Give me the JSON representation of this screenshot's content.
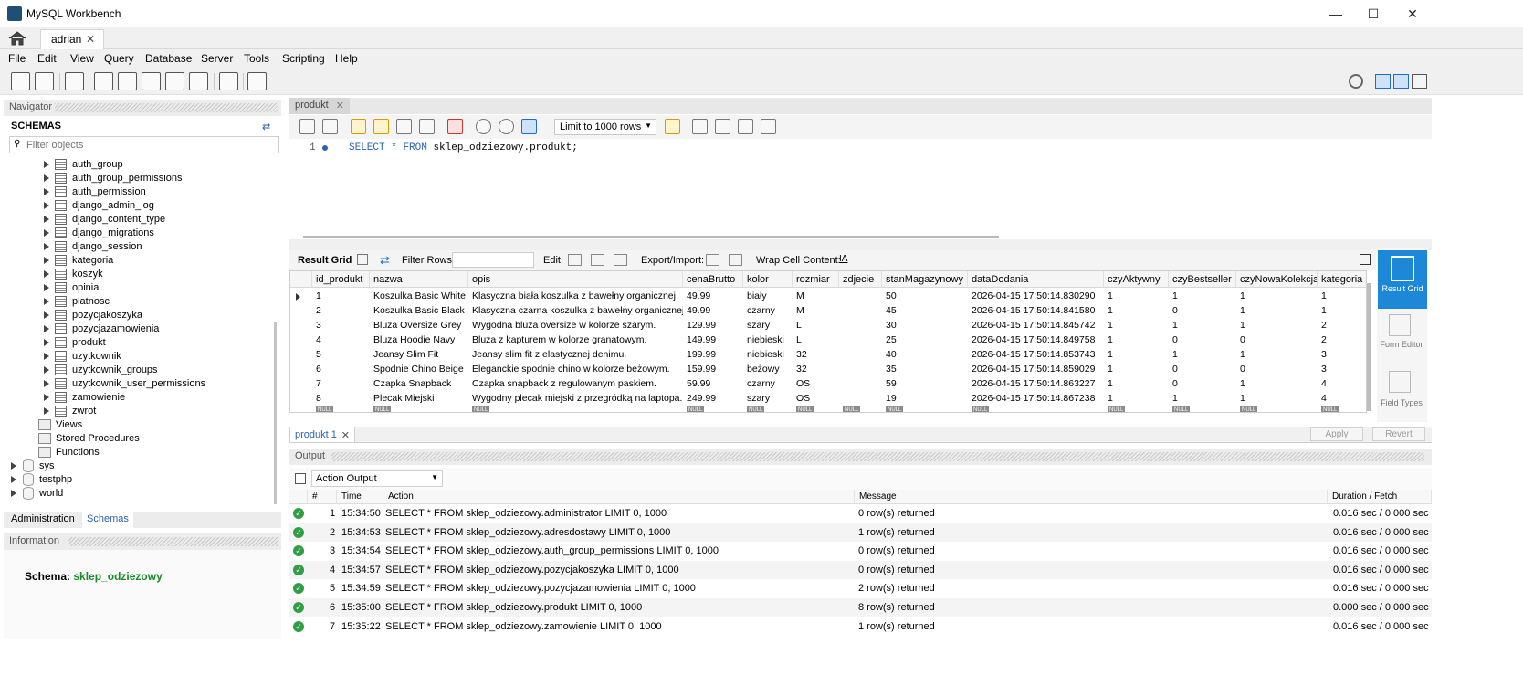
{
  "window": {
    "title": "MySQL Workbench",
    "controls": [
      "minimize",
      "maximize",
      "close"
    ]
  },
  "connection_tab": {
    "label": "adrian",
    "close": "✕"
  },
  "menu": [
    "File",
    "Edit",
    "View",
    "Query",
    "Database",
    "Server",
    "Tools",
    "Scripting",
    "Help"
  ],
  "navigator": {
    "header": "Navigator",
    "schemas_title": "SCHEMAS",
    "filter_placeholder": "Filter objects",
    "tables": [
      "auth_group",
      "auth_group_permissions",
      "auth_permission",
      "django_admin_log",
      "django_content_type",
      "django_migrations",
      "django_session",
      "kategoria",
      "koszyk",
      "opinia",
      "platnosc",
      "pozycjakoszyka",
      "pozycjazamowienia",
      "produkt",
      "uzytkownik",
      "uzytkownik_groups",
      "uzytkownik_user_permissions",
      "zamowienie",
      "zwrot"
    ],
    "folders": [
      "Views",
      "Stored Procedures",
      "Functions"
    ],
    "other_schemas": [
      "sys",
      "testphp",
      "world"
    ],
    "bottom_tabs": [
      "Administration",
      "Schemas"
    ]
  },
  "information": {
    "header": "Information",
    "schema_label": "Schema:",
    "schema_value": "sklep_odziezowy"
  },
  "editor": {
    "tab_label": "produkt",
    "tab_close": "✕",
    "limit_label": "Limit to 1000 rows",
    "line_number": "1",
    "sql_keyword_1": "SELECT",
    "sql_star": "*",
    "sql_keyword_2": "FROM",
    "sql_rest": "sklep_odziezowy.produkt;"
  },
  "result_toolbar": {
    "result_grid": "Result Grid",
    "filter_rows": "Filter Rows:",
    "edit": "Edit:",
    "export_import": "Export/Import:",
    "wrap": "Wrap Cell Content:"
  },
  "grid": {
    "columns": [
      "id_produkt",
      "nazwa",
      "opis",
      "cenaBrutto",
      "kolor",
      "rozmiar",
      "zdjecie",
      "stanMagazynowy",
      "dataDodania",
      "czyAktywny",
      "czyBestseller",
      "czyNowaKolekcja",
      "kategoria"
    ],
    "rows": [
      [
        "1",
        "Koszulka Basic White",
        "Klasyczna biała koszulka z bawełny organicznej.",
        "49.99",
        "biały",
        "M",
        "",
        "50",
        "2026-04-15 17:50:14.830290",
        "1",
        "1",
        "1",
        "1"
      ],
      [
        "2",
        "Koszulka Basic Black",
        "Klasyczna czarna koszulka z bawełny organicznej.",
        "49.99",
        "czarny",
        "M",
        "",
        "45",
        "2026-04-15 17:50:14.841580",
        "1",
        "0",
        "1",
        "1"
      ],
      [
        "3",
        "Bluza Oversize Grey",
        "Wygodna bluza oversize w kolorze szarym.",
        "129.99",
        "szary",
        "L",
        "",
        "30",
        "2026-04-15 17:50:14.845742",
        "1",
        "1",
        "1",
        "2"
      ],
      [
        "4",
        "Bluza Hoodie Navy",
        "Bluza z kapturem w kolorze granatowym.",
        "149.99",
        "niebieski",
        "L",
        "",
        "25",
        "2026-04-15 17:50:14.849758",
        "1",
        "0",
        "0",
        "2"
      ],
      [
        "5",
        "Jeansy Slim Fit",
        "Jeansy slim fit z elastycznej denimu.",
        "199.99",
        "niebieski",
        "32",
        "",
        "40",
        "2026-04-15 17:50:14.853743",
        "1",
        "1",
        "1",
        "3"
      ],
      [
        "6",
        "Spodnie Chino Beige",
        "Eleganckie spodnie chino w kolorze beżowym.",
        "159.99",
        "beżowy",
        "32",
        "",
        "35",
        "2026-04-15 17:50:14.859029",
        "1",
        "0",
        "0",
        "3"
      ],
      [
        "7",
        "Czapka Snapback",
        "Czapka snapback z regulowanym paskiem.",
        "59.99",
        "czarny",
        "OS",
        "",
        "59",
        "2026-04-15 17:50:14.863227",
        "1",
        "0",
        "1",
        "4"
      ],
      [
        "8",
        "Plecak Miejski",
        "Wygodny plecak miejski z przegródką na laptopa.",
        "249.99",
        "szary",
        "OS",
        "",
        "19",
        "2026-04-15 17:50:14.867238",
        "1",
        "1",
        "1",
        "4"
      ]
    ],
    "null_label": "NULL"
  },
  "side_panel": [
    "Result Grid",
    "Form Editor",
    "Field Types"
  ],
  "result_tab": {
    "label": "produkt 1",
    "close": "✕",
    "apply": "Apply",
    "revert": "Revert"
  },
  "output": {
    "header": "Output",
    "mode": "Action Output",
    "columns": [
      "#",
      "Time",
      "Action",
      "Message",
      "Duration / Fetch"
    ],
    "rows": [
      [
        "1",
        "15:34:50",
        "SELECT * FROM sklep_odziezowy.administrator LIMIT 0, 1000",
        "0 row(s) returned",
        "0.016 sec / 0.000 sec"
      ],
      [
        "2",
        "15:34:53",
        "SELECT * FROM sklep_odziezowy.adresdostawy LIMIT 0, 1000",
        "1 row(s) returned",
        "0.016 sec / 0.000 sec"
      ],
      [
        "3",
        "15:34:54",
        "SELECT * FROM sklep_odziezowy.auth_group_permissions LIMIT 0, 1000",
        "0 row(s) returned",
        "0.016 sec / 0.000 sec"
      ],
      [
        "4",
        "15:34:57",
        "SELECT * FROM sklep_odziezowy.pozycjakoszyka LIMIT 0, 1000",
        "0 row(s) returned",
        "0.016 sec / 0.000 sec"
      ],
      [
        "5",
        "15:34:59",
        "SELECT * FROM sklep_odziezowy.pozycjazamowienia LIMIT 0, 1000",
        "2 row(s) returned",
        "0.016 sec / 0.000 sec"
      ],
      [
        "6",
        "15:35:00",
        "SELECT * FROM sklep_odziezowy.produkt LIMIT 0, 1000",
        "8 row(s) returned",
        "0.000 sec / 0.000 sec"
      ],
      [
        "7",
        "15:35:22",
        "SELECT * FROM sklep_odziezowy.zamowienie LIMIT 0, 1000",
        "1 row(s) returned",
        "0.016 sec / 0.000 sec"
      ]
    ]
  },
  "colors": {
    "accent": "#1e88d8",
    "keyword": "#2a62b0",
    "schema_green": "#1a8a2a",
    "ok_green": "#2f9e44"
  }
}
